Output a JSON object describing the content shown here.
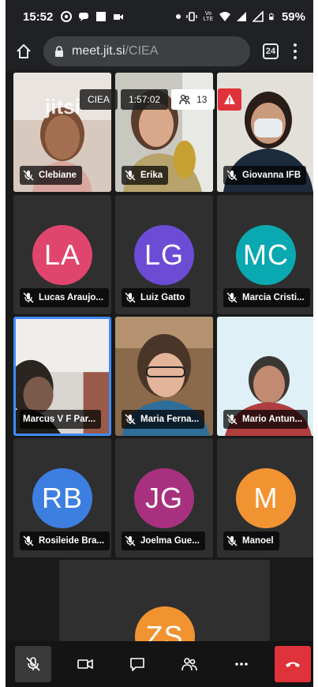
{
  "status_bar": {
    "time": "15:52",
    "battery": "59%",
    "network": "Vo LTE"
  },
  "browser": {
    "url_host": "meet.jit.si",
    "url_path": "/CIEA",
    "tab_count": "24"
  },
  "meeting": {
    "watermark": "jitsi",
    "room_name": "CIEA",
    "elapsed": "1:57:02",
    "participant_count": "13"
  },
  "participants": [
    {
      "name": "Clebiane",
      "type": "video"
    },
    {
      "name": "Erika",
      "type": "video"
    },
    {
      "name": "Giovanna IFB",
      "type": "video"
    },
    {
      "name": "Lucas Araujo...",
      "initials": "LA",
      "color": "#e0466d",
      "type": "avatar"
    },
    {
      "name": "Luiz Gatto",
      "initials": "LG",
      "color": "#6c4cd5",
      "type": "avatar"
    },
    {
      "name": "Marcia Cristi...",
      "initials": "MC",
      "color": "#0aa8b0",
      "type": "avatar"
    },
    {
      "name": "Marcus V F Par...",
      "type": "video",
      "active": true
    },
    {
      "name": "Maria Ferna...",
      "type": "video"
    },
    {
      "name": "Mario Antun...",
      "type": "video"
    },
    {
      "name": "Rosileide Bra...",
      "initials": "RB",
      "color": "#3d7fe0",
      "type": "avatar"
    },
    {
      "name": "Joelma Gue...",
      "initials": "JG",
      "color": "#a8317f",
      "type": "avatar"
    },
    {
      "name": "Manoel",
      "initials": "M",
      "color": "#f29332",
      "type": "avatar"
    },
    {
      "initials": "ZS",
      "color": "#f29332",
      "type": "avatar"
    }
  ],
  "colors": {
    "accent": "#3f8cff",
    "danger": "#e0323a",
    "tile_bg": "#2f2f2f"
  }
}
